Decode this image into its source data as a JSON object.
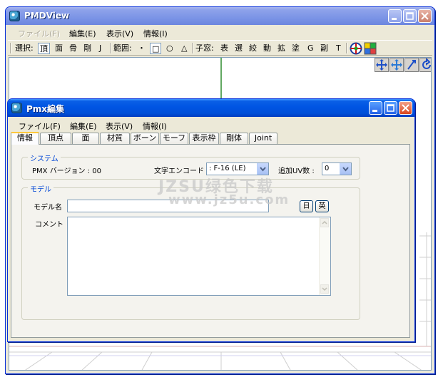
{
  "main_window": {
    "title": "PMDView",
    "menu": [
      {
        "label": "ファイル(F)",
        "enabled": false
      },
      {
        "label": "編集(E)",
        "enabled": true
      },
      {
        "label": "表示(V)",
        "enabled": true
      },
      {
        "label": "情報(I)",
        "enabled": true
      }
    ],
    "toolbar": {
      "select_label": "選択:",
      "select_items": [
        "頂",
        "面",
        "骨",
        "剛",
        "J"
      ],
      "range_label": "範囲:",
      "range_items": [
        "・",
        "□",
        "○",
        "△"
      ],
      "child_label": "子窓:",
      "child_items": [
        "表",
        "選",
        "絞",
        "動",
        "拡",
        "塗",
        "G",
        "副",
        "T"
      ]
    }
  },
  "dialog": {
    "title": "Pmx編集",
    "menu": [
      {
        "label": "ファイル(F)"
      },
      {
        "label": "編集(E)"
      },
      {
        "label": "表示(V)"
      },
      {
        "label": "情報(I)"
      }
    ],
    "tabs": [
      "情報",
      "頂点",
      "面",
      "材質",
      "ボーン",
      "モーフ",
      "表示枠",
      "剛体",
      "Joint"
    ],
    "active_tab": "情報",
    "system": {
      "title": "システム",
      "pmx_version_label": "PMX バージョン : 00",
      "encoding_label": "文字エンコード",
      "encoding_value": ": F-16 (LE)",
      "uv_label": "追加UV数 :",
      "uv_value": "0"
    },
    "model": {
      "title": "モデル",
      "name_label": "モデル名",
      "name_value": "",
      "lang_jp": "日",
      "lang_en": "英",
      "comment_label": "コメント",
      "comment_value": ""
    }
  },
  "watermark": {
    "line1": "JZSU绿色下载",
    "line2": "www.jz5u.com"
  }
}
